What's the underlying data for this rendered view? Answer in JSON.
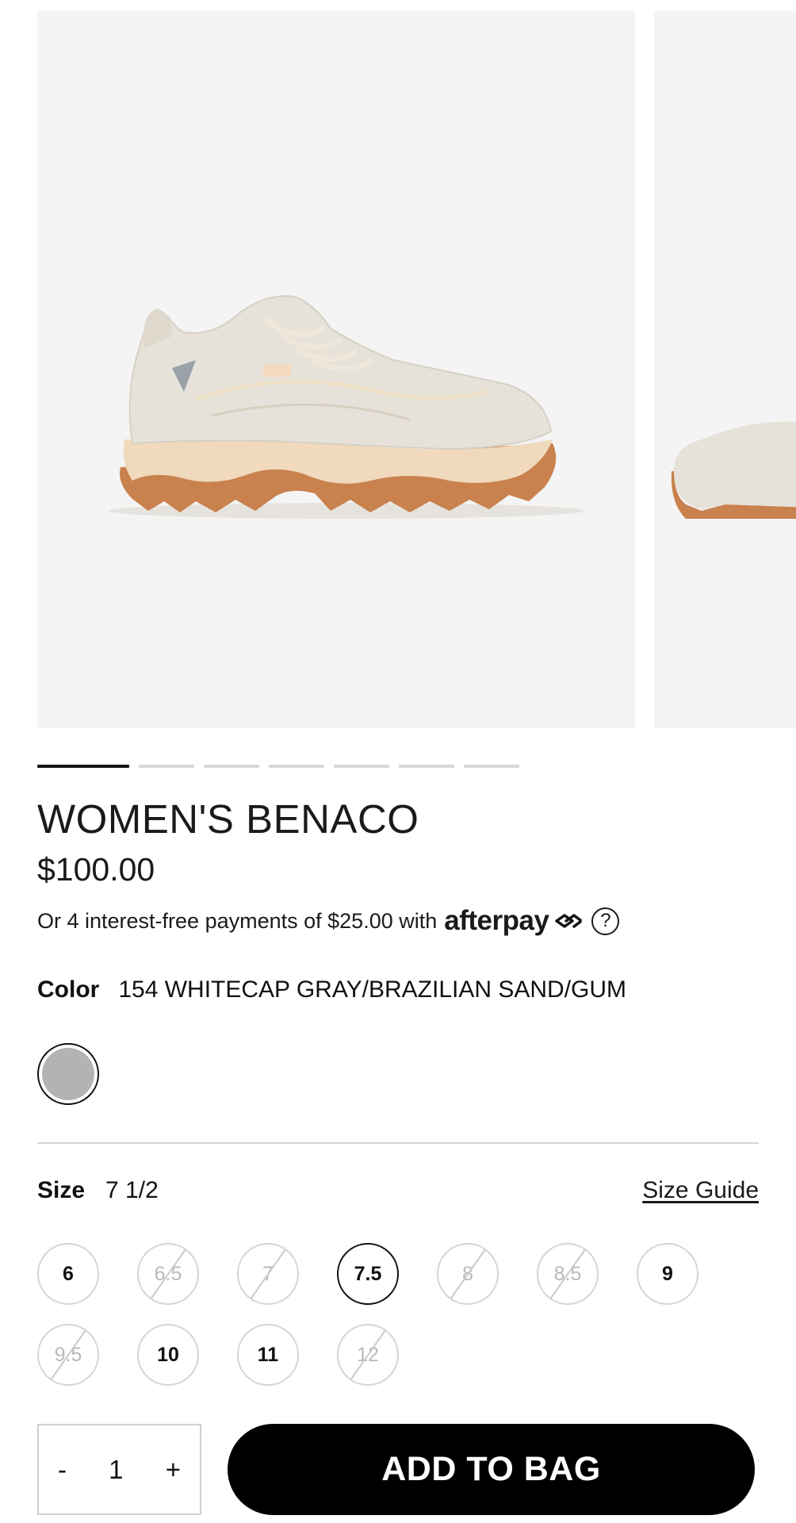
{
  "product": {
    "title": "WOMEN'S BENACO",
    "price": "$100.00",
    "image_icon": "sneaker-image-icon"
  },
  "gallery": {
    "slide_count": 7,
    "active_slide": 1
  },
  "afterpay": {
    "text": "Or 4 interest-free payments of $25.00 with",
    "logo_text": "afterpay",
    "help_icon_text": "?"
  },
  "color": {
    "label": "Color",
    "value": "154 WHITECAP GRAY/BRAZILIAN SAND/GUM",
    "swatch_color": "#b3b3b3"
  },
  "size": {
    "label": "Size",
    "value": "7 1/2",
    "guide_label": "Size Guide",
    "options": [
      {
        "label": "6",
        "available": true,
        "selected": false
      },
      {
        "label": "6.5",
        "available": false,
        "selected": false
      },
      {
        "label": "7",
        "available": false,
        "selected": false
      },
      {
        "label": "7.5",
        "available": true,
        "selected": true
      },
      {
        "label": "8",
        "available": false,
        "selected": false
      },
      {
        "label": "8.5",
        "available": false,
        "selected": false
      },
      {
        "label": "9",
        "available": true,
        "selected": false
      },
      {
        "label": "9.5",
        "available": false,
        "selected": false
      },
      {
        "label": "10",
        "available": true,
        "selected": false
      },
      {
        "label": "11",
        "available": true,
        "selected": false
      },
      {
        "label": "12",
        "available": false,
        "selected": false
      }
    ]
  },
  "quantity": {
    "minus": "-",
    "value": "1",
    "plus": "+"
  },
  "cta": {
    "add_to_bag": "ADD TO BAG"
  }
}
